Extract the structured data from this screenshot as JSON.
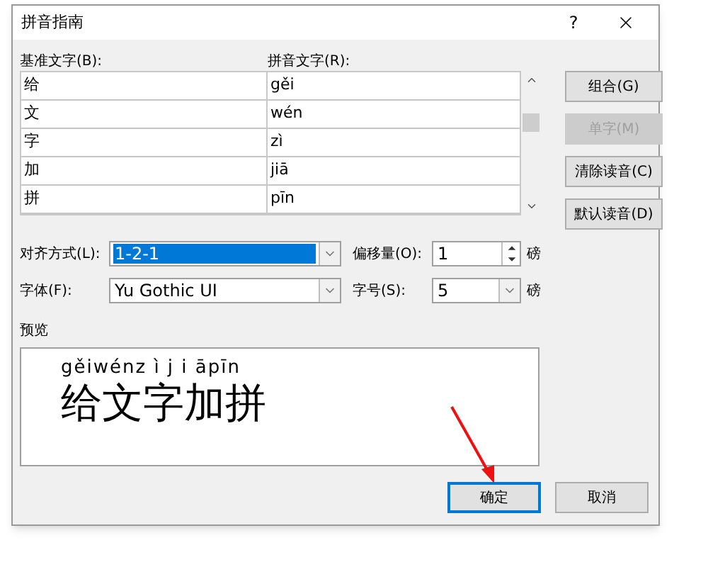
{
  "window": {
    "title": "拼音指南",
    "help": "?"
  },
  "columns": [
    "基准文字(B):",
    "拼音文字(R):"
  ],
  "rows": [
    {
      "base": "给",
      "ruby": "gěi"
    },
    {
      "base": "文",
      "ruby": "wén"
    },
    {
      "base": "字",
      "ruby": "zì"
    },
    {
      "base": "加",
      "ruby": "jiā"
    },
    {
      "base": "拼",
      "ruby": "pīn"
    }
  ],
  "side_buttons": [
    {
      "label": "组合(G)",
      "disabled": false
    },
    {
      "label": "单字(M)",
      "disabled": true
    },
    {
      "label": "清除读音(C)",
      "disabled": false
    },
    {
      "label": "默认读音(D)",
      "disabled": false
    }
  ],
  "alignment": {
    "label": "对齐方式(L):",
    "value": "1-2-1",
    "highlighted": true
  },
  "offset": {
    "label": "偏移量(O):",
    "value": "1",
    "unit": "磅"
  },
  "font": {
    "label": "字体(F):",
    "value": "Yu Gothic UI"
  },
  "size": {
    "label": "字号(S):",
    "value": "5",
    "unit": "磅"
  },
  "preview": {
    "label": "预览",
    "ruby": "gěiwénz ì j i āpīn",
    "text": "给文字加拼"
  },
  "buttons": [
    {
      "label": "确定",
      "default": true
    },
    {
      "label": "取消",
      "default": false
    }
  ]
}
